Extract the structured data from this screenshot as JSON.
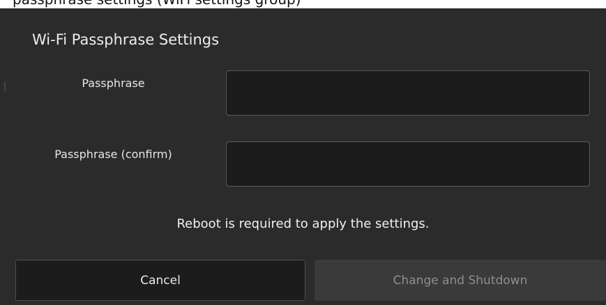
{
  "background": {
    "partial_text": "passphrase settings (WiFi settings group)"
  },
  "dialog": {
    "title": "Wi-Fi Passphrase Settings",
    "fields": [
      {
        "label": "Passphrase",
        "value": ""
      },
      {
        "label": "Passphrase (confirm)",
        "value": ""
      }
    ],
    "notice": "Reboot is required to apply the settings.",
    "buttons": {
      "cancel_label": "Cancel",
      "change_label": "Change and Shutdown"
    }
  },
  "colors": {
    "dialog_bg": "#2b2b2c",
    "input_bg": "#1c1c1d",
    "disabled_text": "#8e8e90"
  }
}
